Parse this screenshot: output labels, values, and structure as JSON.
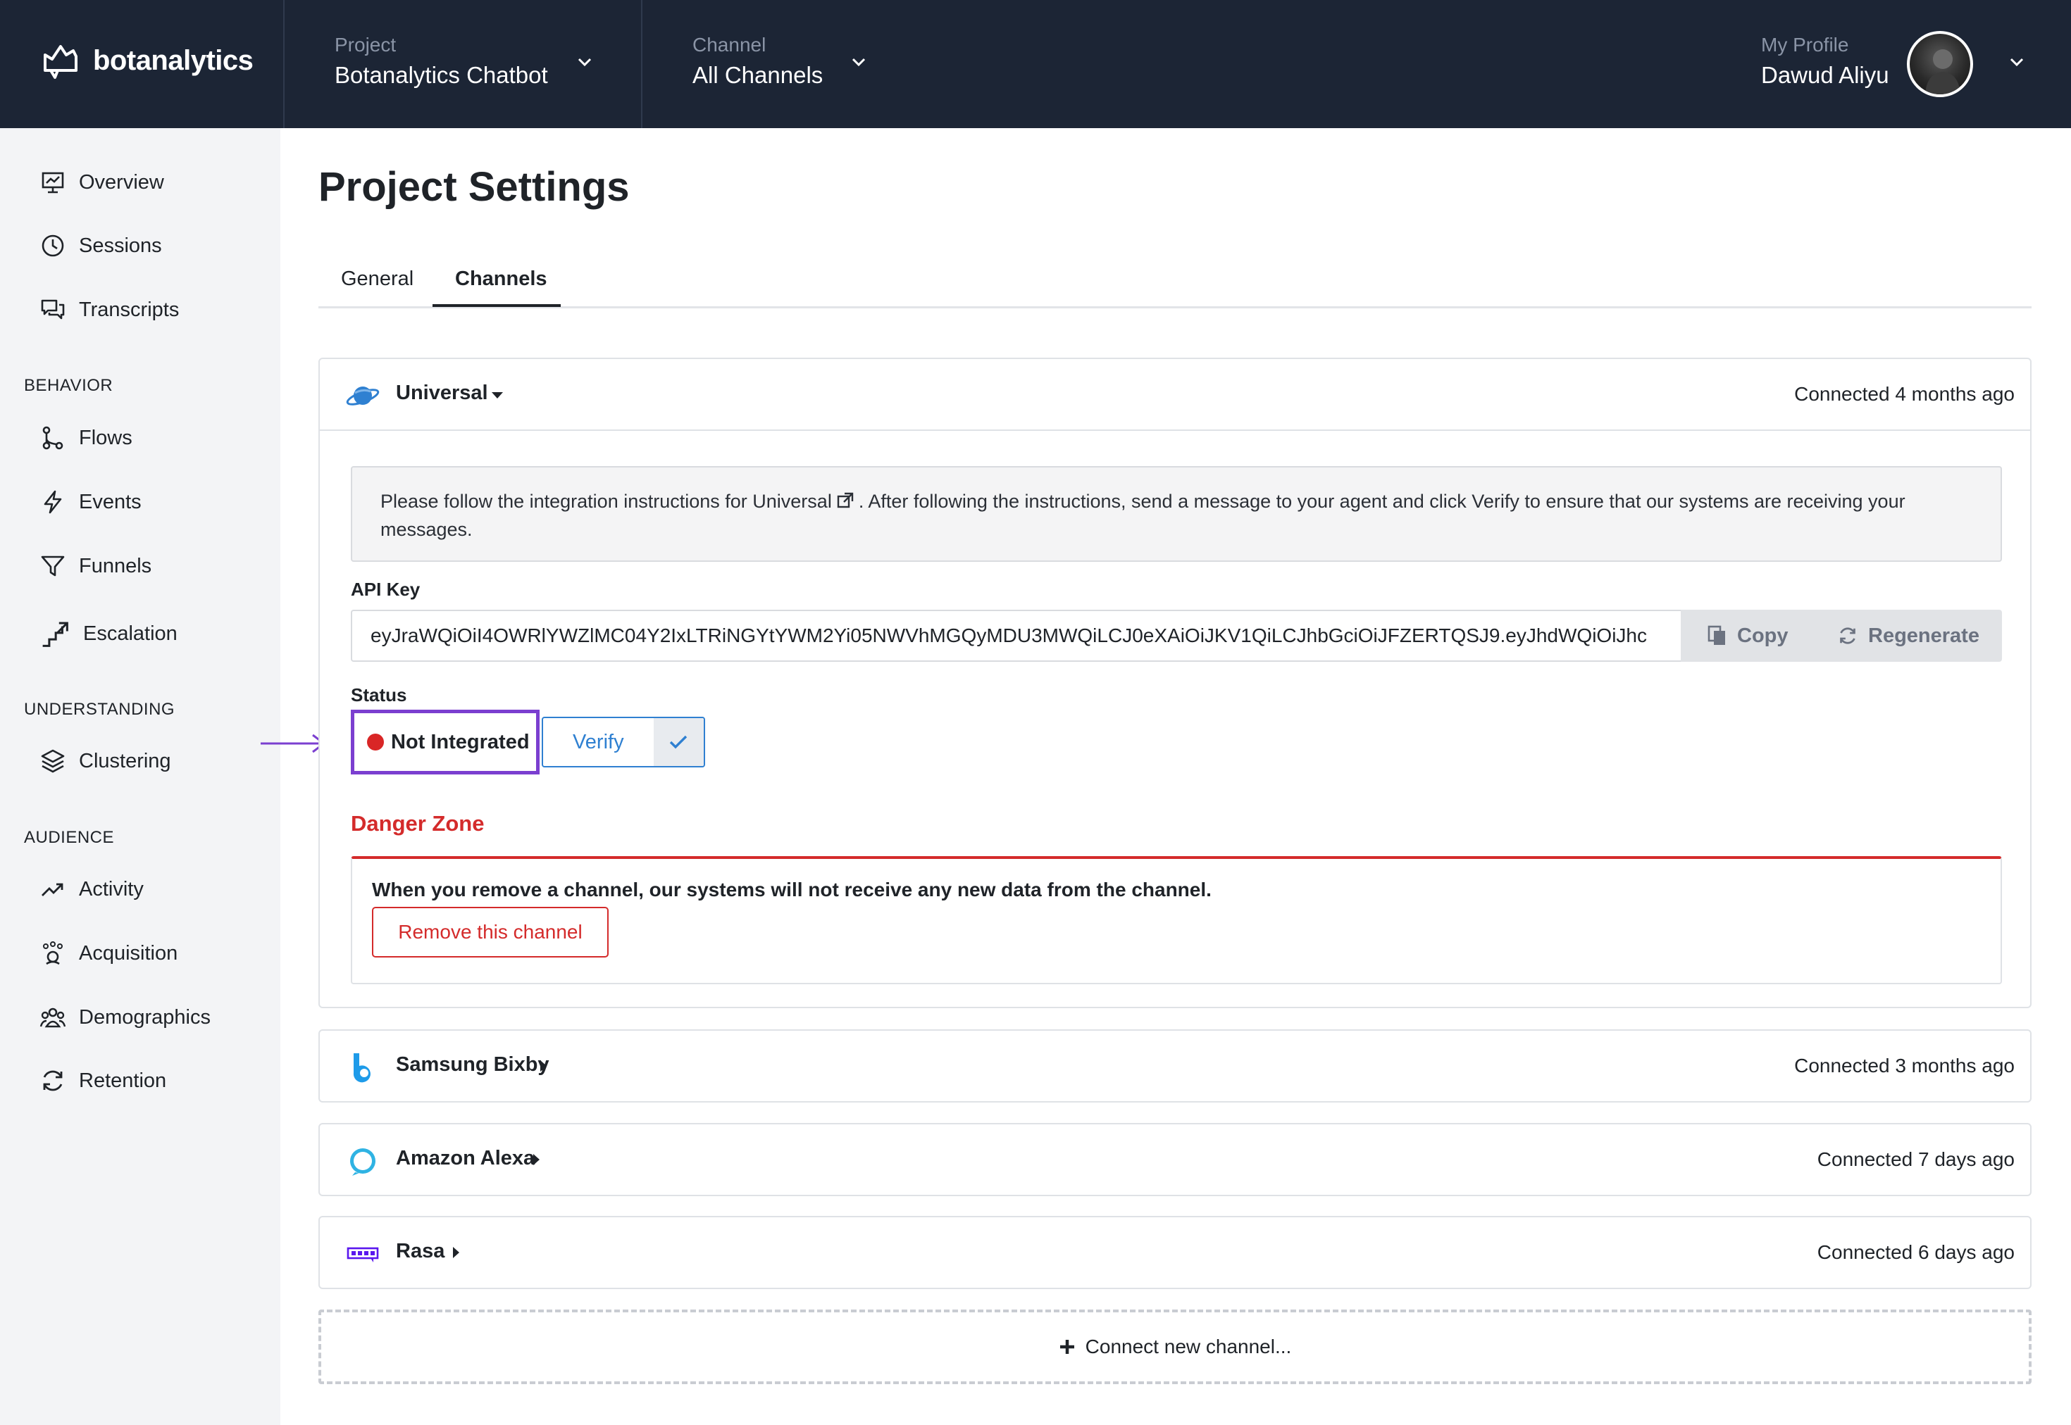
{
  "header": {
    "brand": "botanalytics",
    "project": {
      "label": "Project",
      "value": "Botanalytics Chatbot"
    },
    "channel": {
      "label": "Channel",
      "value": "All Channels"
    },
    "profile": {
      "label": "My Profile",
      "name": "Dawud Aliyu"
    }
  },
  "sidebar": {
    "top_items": [
      {
        "label": "Overview",
        "icon": "chart-board-icon"
      },
      {
        "label": "Sessions",
        "icon": "clock-icon"
      },
      {
        "label": "Transcripts",
        "icon": "chat-bubbles-icon"
      }
    ],
    "sections": [
      {
        "title": "BEHAVIOR",
        "items": [
          {
            "label": "Flows",
            "icon": "flow-icon"
          },
          {
            "label": "Events",
            "icon": "lightning-icon"
          },
          {
            "label": "Funnels",
            "icon": "funnel-icon"
          },
          {
            "label": "Escalation",
            "icon": "escalation-icon"
          }
        ]
      },
      {
        "title": "UNDERSTANDING",
        "items": [
          {
            "label": "Clustering",
            "icon": "layers-icon"
          }
        ]
      },
      {
        "title": "AUDIENCE",
        "items": [
          {
            "label": "Activity",
            "icon": "trend-up-icon"
          },
          {
            "label": "Acquisition",
            "icon": "acquisition-icon"
          },
          {
            "label": "Demographics",
            "icon": "users-icon"
          },
          {
            "label": "Retention",
            "icon": "refresh-icon"
          }
        ]
      }
    ]
  },
  "main": {
    "title": "Project Settings",
    "tabs": [
      {
        "label": "General"
      },
      {
        "label": "Channels"
      }
    ],
    "active_tab": "Channels",
    "universal": {
      "name": "Universal",
      "connected": "Connected 4 months ago",
      "instructions_pre": "Please follow the integration instructions for Universal",
      "instructions_post": ". After following the instructions, send a message to your agent and click Verify to ensure that our systems are receiving your messages.",
      "api_key_label": "API Key",
      "api_key_value": "eyJraWQiOiI4OWRlYWZlMC04Y2IxLTRiNGYtYWM2Yi05NWVhMGQyMDU3MWQiLCJ0eXAiOiJKV1QiLCJhbGciOiJFZERTQSJ9.eyJhdWQiOiJhc",
      "copy_label": "Copy",
      "regenerate_label": "Regenerate",
      "status_label": "Status",
      "status_value": "Not Integrated",
      "verify_label": "Verify",
      "danger_title": "Danger Zone",
      "danger_text": "When you remove a channel, our systems will not receive any new data from the channel.",
      "remove_label": "Remove this channel"
    },
    "channels": [
      {
        "name": "Samsung Bixby",
        "connected": "Connected 3 months ago"
      },
      {
        "name": "Amazon Alexa",
        "connected": "Connected 7 days ago"
      },
      {
        "name": "Rasa",
        "connected": "Connected 6 days ago"
      }
    ],
    "connect_label": "Connect new channel..."
  },
  "colors": {
    "topbar": "#1c2535",
    "accent_blue": "#2f80d1",
    "danger_red": "#d42b2b",
    "highlight_purple": "#7b3fd0",
    "status_dot": "#d92626"
  }
}
